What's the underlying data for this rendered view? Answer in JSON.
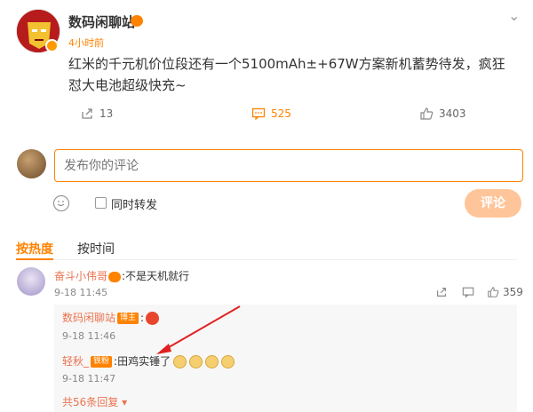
{
  "post": {
    "author": "数码闲聊站",
    "time": "4小时前",
    "text": "红米的千元机价位段还有一个5100mAh±+67W方案新机蓄势待发，疯狂怼大电池超级快充~",
    "reposts": "13",
    "comments": "525",
    "likes": "3403"
  },
  "composer": {
    "placeholder": "发布你的评论",
    "repost_label": "同时转发",
    "submit_label": "评论"
  },
  "tabs": [
    {
      "label": "按热度",
      "active": true
    },
    {
      "label": "按时间",
      "active": false
    }
  ],
  "comments": [
    {
      "author": "奋斗小伟哥",
      "text": ":不是天机就行",
      "time": "9-18 11:45",
      "likes": "359",
      "replies": [
        {
          "author": "数码闲聊站",
          "badge": "博主",
          "text": ":",
          "time": "9-18 11:46"
        },
        {
          "author": "轻秋_",
          "badge": "铁粉",
          "text": ":田鸡实锤了",
          "time": "9-18 11:47"
        }
      ],
      "more_replies": "共56条回复"
    }
  ],
  "colors": {
    "accent": "#ff8200",
    "name": "#eb7350",
    "annotation_arrow": "#e02020"
  }
}
